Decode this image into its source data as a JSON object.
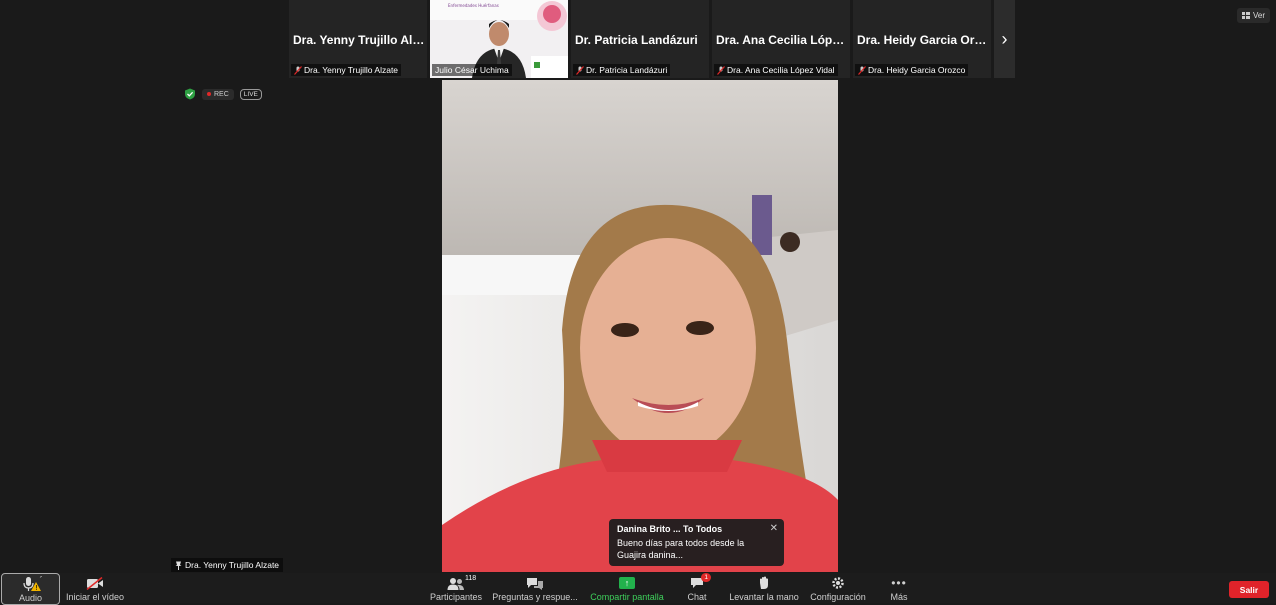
{
  "top_strip": {
    "tiles": [
      {
        "display_name": "Dra. Yenny Trujillo Alz...",
        "label": "Dra. Yenny Trujillo Alzate",
        "muted": true
      },
      {
        "display_name": "",
        "label": "Julio César Uchima",
        "muted": false
      },
      {
        "display_name": "Dr. Patricia Landázuri",
        "label": "Dr. Patricia Landázuri",
        "muted": true
      },
      {
        "display_name": "Dra. Ana Cecilia López ...",
        "label": "Dra. Ana Cecilia López Vidal",
        "muted": true
      },
      {
        "display_name": "Dra. Heidy Garcia Oroz...",
        "label": "Dra. Heidy Garcia Orozco",
        "muted": true
      }
    ],
    "next_icon": "chevron-right-icon"
  },
  "view_button": {
    "label": "Ver",
    "icon": "grid-icon"
  },
  "status": {
    "rec_label": "REC",
    "live_label": "LIVE"
  },
  "active_speaker": {
    "label": "Dra. Yenny Trujillo Alzate"
  },
  "chat_popup": {
    "from": "Danina Brito ... To Todos",
    "message": "Bueno días para todos desde la Guajira danina..."
  },
  "toolbar": {
    "audio": "Audio",
    "video": "Iniciar el vídeo",
    "participants": "Participantes",
    "participants_count": "118",
    "qa": "Preguntas y respue...",
    "share": "Compartir pantalla",
    "chat": "Chat",
    "chat_badge": "1",
    "raise_hand": "Levantar la mano",
    "settings": "Configuración",
    "more": "Más",
    "leave": "Salir"
  },
  "colors": {
    "background": "#1a1a1a",
    "share_green": "#22b14c",
    "leave_red": "#e0232a"
  }
}
